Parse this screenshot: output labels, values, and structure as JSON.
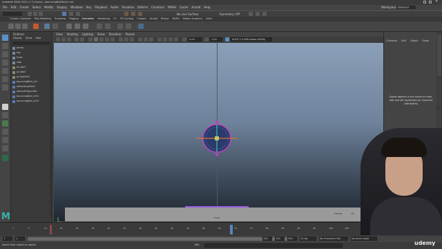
{
  "window": {
    "title": "Autodesk MAYA 2022.1: C:\\Users\\...\\bouncingBallDone1.mb"
  },
  "menus": [
    "File",
    "Edit",
    "Create",
    "Select",
    "Modify",
    "Display",
    "Windows",
    "Key",
    "Playback",
    "Audio",
    "Visualize",
    "Deform",
    "Constrain",
    "MASH",
    "Cache",
    "Arnold",
    "Help"
  ],
  "status": {
    "workspace_label": "Workspace:",
    "workspace_value": "General",
    "no_live_surface": "No Live Surface",
    "symmetry": "Symmetry: Off"
  },
  "shelf_tabs": [
    "Curves / Surfaces",
    "Poly Modeling",
    "Sculpting",
    "Rigging",
    "Animation",
    "Rendering",
    "FX",
    "FX Caching",
    "Custom",
    "Arnold",
    "Bifrost",
    "MASH",
    "Motion Graphics",
    "XGen"
  ],
  "outliner": {
    "title": "Outliner",
    "menu": [
      "Display",
      "Show",
      "Help"
    ],
    "items": [
      "persp",
      "top",
      "front",
      "side",
      "pCube1",
      "pCube2",
      "pCubeSet1",
      "bouncingBall_ctrl",
      "defaultLightSet",
      "defaultObjectSet",
      "bouncingBall_ctrl1",
      "bouncingBall_ctrl2"
    ]
  },
  "panel": {
    "menu": [
      "View",
      "Shading",
      "Lighting",
      "Show",
      "Renderer",
      "Panels"
    ],
    "colorspace": "ACES 1.0 SDR-video (sRGB)",
    "value1": "0.00",
    "value2": "1.00"
  },
  "viewport": {
    "frame_label": "Frame:",
    "frame_value": "10",
    "fps": "23.4 fps",
    "cam_label": "front"
  },
  "channel_box": {
    "tabs": [
      "Channels",
      "Edit",
      "Object",
      "Show"
    ],
    "hint": "Select objects in the scene to view, edit and set keyframes on channels (attributes)"
  },
  "timeline": {
    "ticks": [
      "1",
      "5",
      "10",
      "15",
      "20",
      "25",
      "30",
      "35",
      "40",
      "45",
      "50",
      "55",
      "60",
      "65",
      "70",
      "75",
      "80",
      "85",
      "90",
      "95",
      "100",
      "105",
      "110",
      "115",
      "120"
    ],
    "current_frame": "10"
  },
  "range": {
    "start": "1",
    "start2": "1",
    "end": "120",
    "end2": "120",
    "end3": "200",
    "fps": "24 fps",
    "char_set": "No Character Set",
    "anim_layer": "No Anim Layer"
  },
  "command": {
    "lang": "MEL",
    "help": "Select Tool: select an object"
  },
  "colors": {
    "accent": "#5b8fc7",
    "ball": "#2a3a6a",
    "ball_rim": "#c040c0",
    "manip_x": "#e07030",
    "manip_y": "#40c0a0"
  },
  "watermark": "udemy"
}
